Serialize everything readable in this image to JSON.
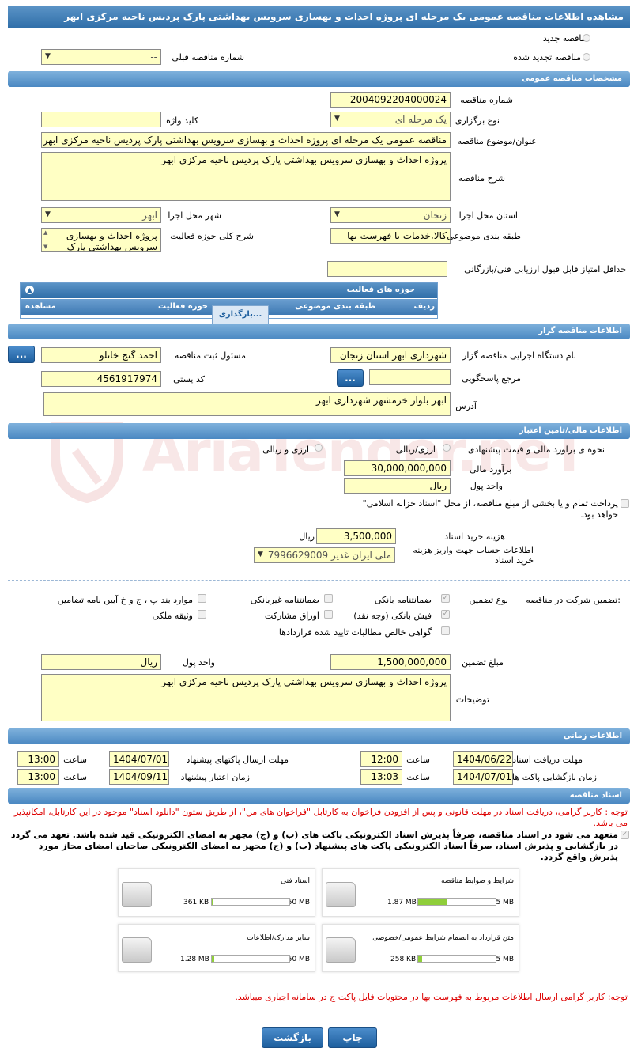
{
  "page_title": "مشاهده اطلاعات مناقصه عمومی یک مرحله ای پروژه احداث و بهسازی سرویس بهداشتی پارک پردیس ناحیه مرکزی ابهر",
  "watermark": "AriaTender.neT",
  "tender_type": {
    "new_label": "مناقصه جدید",
    "renewed_label": "مناقصه تجدید شده",
    "prev_number_label": "شماره مناقصه قبلی",
    "prev_number_value": "--"
  },
  "general": {
    "header": "مشخصات مناقصه عمومی",
    "number_label": "شماره مناقصه",
    "number_value": "2004092204000024",
    "type_label": "نوع برگزاری",
    "type_value": "یک مرحله ای",
    "keyword_label": "کلید واژه",
    "keyword_value": "",
    "subject_label": "عنوان/موضوع مناقصه",
    "subject_value": "مناقصه عمومی یک مرحله ای پروژه احداث و بهسازی سرویس بهداشتی پارک پردیس ناحیه مرکزی ابهر",
    "desc_label": "شرح مناقصه",
    "desc_value": "پروژه احداث و بهسازی سرویس بهداشتی پارک پردیس ناحیه مرکزی ابهر",
    "province_label": "استان محل اجرا",
    "province_value": "زنجان",
    "city_label": "شهر محل اجرا",
    "city_value": "ابهر",
    "category_label": "طبقه بندی موضوعی",
    "category_value": "کالا،خدمات با فهرست بها",
    "activity_desc_label": "شرح کلی حوزه فعالیت",
    "activity_desc_value": "پروژه احداث و بهسازی سرویس بهداشتی پارک",
    "min_score_label": "حداقل امتیاز قابل قبول ارزیابی فنی/بازرگانی",
    "min_score_value": ""
  },
  "activity_grid": {
    "title": "حوزه های فعالیت",
    "columns": [
      "ردیف",
      "طبقه بندی موضوعی",
      "حوزه فعالیت",
      "مشاهده"
    ],
    "loading": "بارگذاری..."
  },
  "organizer": {
    "header": "اطلاعات مناقصه گزار",
    "org_label": "نام دستگاه اجرایی مناقصه گزار",
    "org_value": "شهرداری ابهر استان زنجان",
    "registrar_label": "مسئول ثبت مناقصه",
    "registrar_value": "احمد گنج خانلو",
    "ref_label": "مرجع پاسخگویی",
    "ref_value": "",
    "postal_label": "کد پستی",
    "postal_value": "4561917974",
    "address_label": "آدرس",
    "address_value": "ابهر بلوار خرمشهر شهرداری ابهر",
    "more_button": "..."
  },
  "finance": {
    "header": "اطلاعات مالی/تامین اعتبار",
    "estimate_label": "نحوه ی برآورد مالی و قیمت پیشنهادی",
    "opt_rial_currency": "ارزی/ریالی",
    "opt_currency_and_rial": "ارزی و ریالی",
    "estimate_amount_label": "برآورد مالی",
    "estimate_amount_value": "30,000,000,000",
    "currency_unit_label": "واحد پول",
    "currency_unit_value": "ریال",
    "treasury_note": "پرداخت تمام و یا بخشی از مبلغ مناقصه، از محل \"اسناد خزانه اسلامی\" خواهد بود.",
    "doc_cost_label": "هزینه خرید اسناد",
    "doc_cost_value": "3,500,000",
    "doc_cost_unit": "ریال",
    "account_label": "اطلاعات حساب جهت واریز هزینه خرید اسناد",
    "account_value": "ملی ایران غدیر 7996629009"
  },
  "guarantee": {
    "participation_label": "تضمین شرکت در مناقصه:",
    "type_label": "نوع تضمین",
    "options": [
      {
        "label": "ضمانتنامه بانکی",
        "checked": true
      },
      {
        "label": "ضمانتنامه غیربانکی",
        "checked": false
      },
      {
        "label": "موارد بند پ ، ج و خ آیین نامه تضامین",
        "checked": false
      },
      {
        "label": "فیش بانکی (وجه نقد)",
        "checked": true
      },
      {
        "label": "اوراق مشارکت",
        "checked": false
      },
      {
        "label": "وثیقه ملکی",
        "checked": false
      },
      {
        "label": "گواهی خالص مطالبات تایید شده قراردادها",
        "checked": false
      }
    ],
    "amount_label": "مبلغ تضمین",
    "amount_value": "1,500,000,000",
    "unit_label": "واحد پول",
    "unit_value": "ریال",
    "notes_label": "توضیحات",
    "notes_value": "پروژه احداث و بهسازی سرویس بهداشتی پارک پردیس ناحیه مرکزی ابهر"
  },
  "timing": {
    "header": "اطلاعات زمانی",
    "doc_deadline_label": "مهلت دریافت اسناد",
    "doc_deadline_date": "1404/06/22",
    "doc_deadline_time": "12:00",
    "submit_deadline_label": "مهلت ارسال پاکتهای پیشنهاد",
    "submit_deadline_date": "1404/07/01",
    "submit_deadline_time": "13:00",
    "opening_label": "زمان بازگشایی پاکت ها",
    "opening_date": "1404/07/01",
    "opening_time": "13:03",
    "validity_label": "زمان اعتبار پیشنهاد",
    "validity_date": "1404/09/11",
    "validity_time": "13:00",
    "time_label": "ساعت"
  },
  "documents": {
    "header": "اسناد مناقصه",
    "notice": "توجه : کاربر گرامی، دریافت اسناد در مهلت قانونی و پس از افزودن فراخوان به کارتابل \"فراخوان های من\"، از طریق ستون \"دانلود اسناد\" موجود در این کارتابل، امکانپذیر می باشد.",
    "commitment": "متعهد می شود در اسناد مناقصه، صرفاً پذیرش اسناد الکترونیکی پاکت های (ب) و (ج) مجهز به امضای الکترونیکی قید شده باشد. تعهد می گردد در بازگشایی و پذیرش اسناد، صرفاً اسناد الکترونیکی پاکت های پیشنهاد (ب) و (ج) مجهز به امضای الکترونیکی صاحبان امضای مجاز مورد پذیرش واقع گردد.",
    "files": [
      {
        "title": "شرایط و ضوابط مناقصه",
        "size": "1.87 MB",
        "max": "5 MB",
        "fraction": 0.37
      },
      {
        "title": "اسناد فنی",
        "size": "361 KB",
        "max": "50 MB",
        "fraction": 0.01
      },
      {
        "title": "متن قرارداد به انضمام شرایط عمومی/خصوصی",
        "size": "258 KB",
        "max": "5 MB",
        "fraction": 0.05
      },
      {
        "title": "سایر مدارک/اطلاعات",
        "size": "1.28 MB",
        "max": "50 MB",
        "fraction": 0.03
      }
    ],
    "footer_note": "توجه: کاربر گرامی ارسال اطلاعات مربوط به فهرست بها در محتویات فایل پاکت ج در سامانه اجباری میباشد."
  },
  "actions": {
    "print": "چاپ",
    "back": "بازگشت"
  }
}
